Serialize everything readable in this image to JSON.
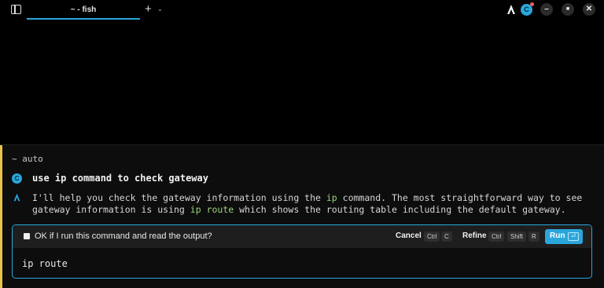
{
  "titlebar": {
    "tab_title": "~ - fish",
    "new_tab_icon": "plus-icon",
    "avatar_letter": "C",
    "minimize": "–",
    "maximize": "■",
    "close": "✕"
  },
  "colors": {
    "accent": "#2aa6dc",
    "block_marker": "#e8c24a",
    "highlight": "#9bd57a",
    "background": "#000000"
  },
  "ai_block": {
    "prompt": "~ auto",
    "query_avatar": "C",
    "query": "use ip command to check gateway",
    "response": {
      "p1": "I'll help you check the gateway information using the ",
      "code1": "ip",
      "p2": " command. The most straightforward way to see gateway information is using ",
      "code2": "ip route",
      "p3": " which shows the routing table including the default gateway."
    },
    "card": {
      "question": "OK if I run this command and read the output?",
      "cancel_label": "Cancel",
      "cancel_keys": [
        "Ctrl",
        "C"
      ],
      "refine_label": "Refine",
      "refine_keys": [
        "Ctrl",
        "Shift",
        "R"
      ],
      "run_label": "Run",
      "run_key": "⏎",
      "command": "ip route"
    }
  }
}
